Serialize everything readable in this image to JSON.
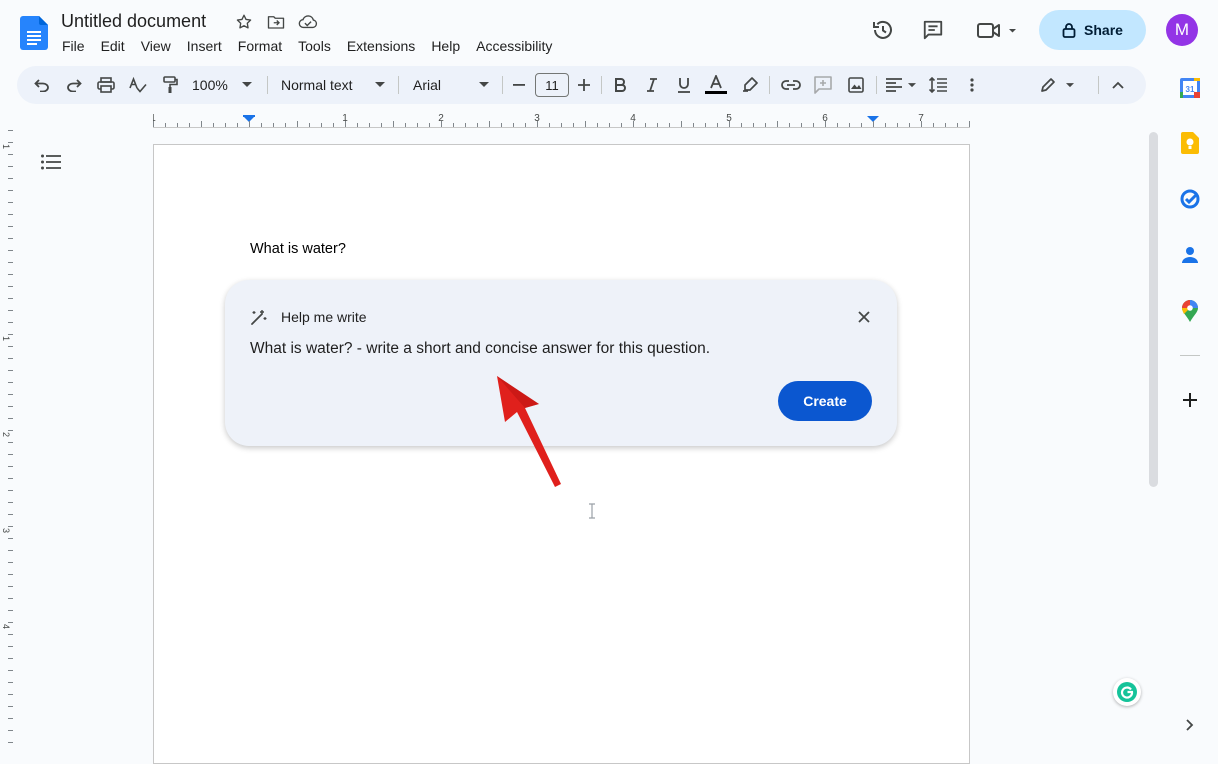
{
  "header": {
    "doc_title": "Untitled document",
    "menu": [
      "File",
      "Edit",
      "View",
      "Insert",
      "Format",
      "Tools",
      "Extensions",
      "Help",
      "Accessibility"
    ],
    "share_label": "Share",
    "avatar_initial": "M"
  },
  "toolbar": {
    "zoom": "100%",
    "style": "Normal text",
    "font": "Arial",
    "font_size": "11"
  },
  "ruler": {
    "labels": [
      "1",
      "1",
      "2",
      "3",
      "4",
      "5",
      "6",
      "7"
    ]
  },
  "vruler": {
    "labels": [
      "1",
      "1",
      "2",
      "3",
      "4"
    ]
  },
  "document": {
    "text": "What is water?"
  },
  "help_me_write": {
    "title": "Help me write",
    "prompt": "What is water? - write a short and concise answer for this question.",
    "create_label": "Create"
  },
  "colors": {
    "accent": "#0b57d0",
    "share_bg": "#c2e7ff",
    "avatar": "#9334e6",
    "arrow": "#e0201c"
  }
}
